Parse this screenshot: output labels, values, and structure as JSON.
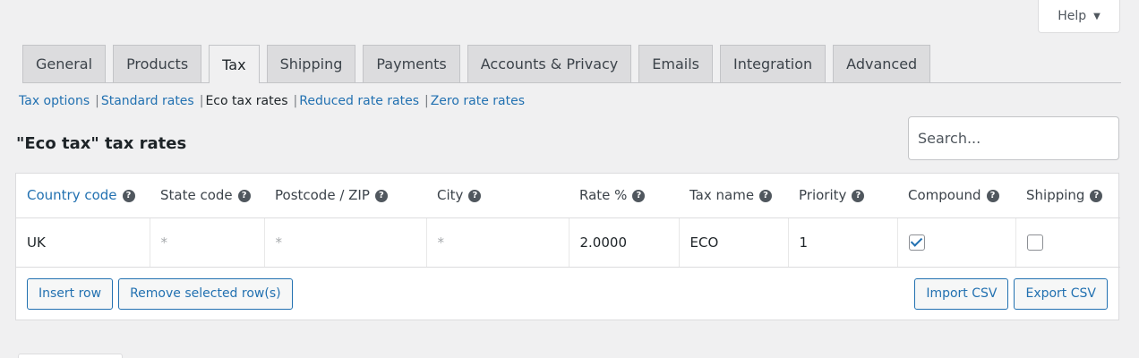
{
  "help": {
    "label": "Help",
    "caret": "▼"
  },
  "tabs": [
    {
      "label": "General"
    },
    {
      "label": "Products"
    },
    {
      "label": "Tax",
      "active": true
    },
    {
      "label": "Shipping"
    },
    {
      "label": "Payments"
    },
    {
      "label": "Accounts & Privacy"
    },
    {
      "label": "Emails"
    },
    {
      "label": "Integration"
    },
    {
      "label": "Advanced"
    }
  ],
  "subnav": [
    {
      "label": "Tax options"
    },
    {
      "label": "Standard rates"
    },
    {
      "label": "Eco tax rates",
      "current": true
    },
    {
      "label": "Reduced rate rates"
    },
    {
      "label": "Zero rate rates"
    }
  ],
  "section_title": "\"Eco tax\" tax rates",
  "search": {
    "placeholder": "Search..."
  },
  "table": {
    "columns": [
      "Country code",
      "State code",
      "Postcode / ZIP",
      "City",
      "Rate %",
      "Tax name",
      "Priority",
      "Compound",
      "Shipping"
    ],
    "rows": [
      {
        "country": "UK",
        "state": "*",
        "postcode": "*",
        "city": "*",
        "rate": "2.0000",
        "tax_name": "ECO",
        "priority": "1",
        "compound": true,
        "shipping": false
      }
    ]
  },
  "buttons": {
    "insert_row": "Insert row",
    "remove_rows": "Remove selected row(s)",
    "import_csv": "Import CSV",
    "export_csv": "Export CSV"
  },
  "icons": {
    "help_tip": "question-circle-icon",
    "checkmark": "checkmark-icon"
  },
  "colors": {
    "accent": "#2271b1",
    "background": "#f0f0f1"
  }
}
